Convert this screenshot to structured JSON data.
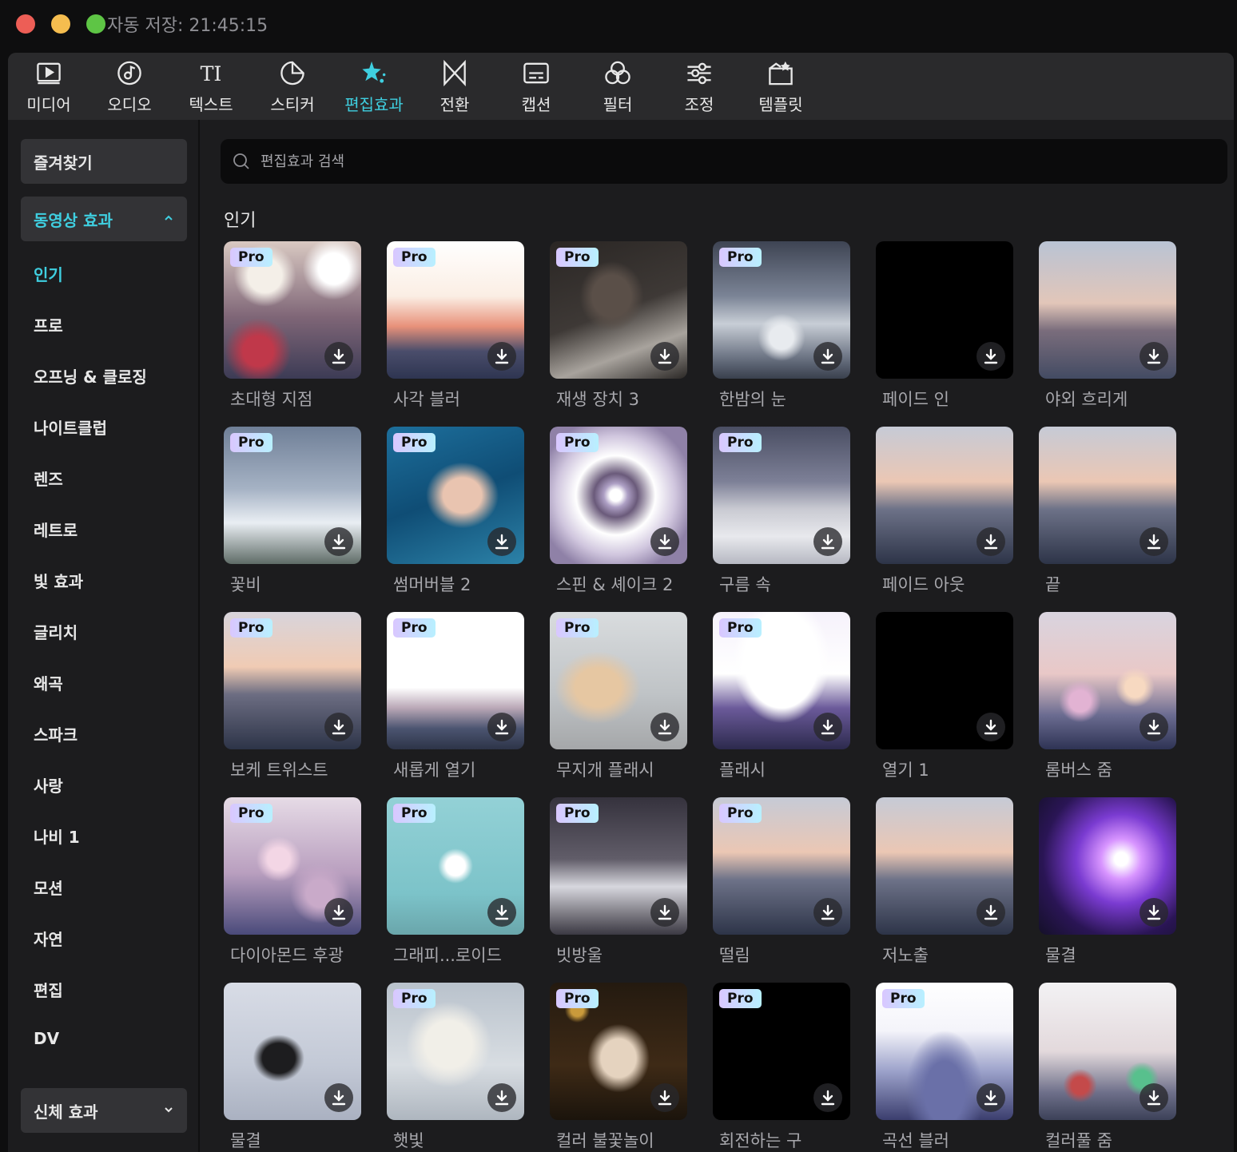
{
  "titlebar": {
    "autosave": "자동 저장: 21:45:15"
  },
  "toolbar": [
    {
      "label": "미디어",
      "icon": "media-icon",
      "active": false
    },
    {
      "label": "오디오",
      "icon": "audio-icon",
      "active": false
    },
    {
      "label": "텍스트",
      "icon": "text-icon",
      "active": false
    },
    {
      "label": "스티커",
      "icon": "sticker-icon",
      "active": false
    },
    {
      "label": "편집효과",
      "icon": "effects-icon",
      "active": true
    },
    {
      "label": "전환",
      "icon": "transition-icon",
      "active": false
    },
    {
      "label": "캡션",
      "icon": "caption-icon",
      "active": false
    },
    {
      "label": "필터",
      "icon": "filter-icon",
      "active": false
    },
    {
      "label": "조정",
      "icon": "adjust-icon",
      "active": false
    },
    {
      "label": "템플릿",
      "icon": "template-icon",
      "active": false
    }
  ],
  "sidebar": {
    "favorites": "즐겨찾기",
    "video_effects": "동영상 효과",
    "items": [
      "인기",
      "프로",
      "오프닝 & 클로징",
      "나이트클럽",
      "렌즈",
      "레트로",
      "빛 효과",
      "글리치",
      "왜곡",
      "스파크",
      "사랑",
      "나비 1",
      "모션",
      "자연",
      "편집",
      "DV"
    ],
    "active_item": "인기",
    "body_effects": "신체 효과"
  },
  "search": {
    "placeholder": "편집효과 검색"
  },
  "section_title": "인기",
  "pro_label": "Pro",
  "colors": {
    "accent": "#3fcfe0",
    "background": "#1c1c1e",
    "panel": "#2a2a2c"
  },
  "effects": [
    {
      "name": "초대형 지점",
      "pro": true
    },
    {
      "name": "사각 블러",
      "pro": true
    },
    {
      "name": "재생 장치 3",
      "pro": true
    },
    {
      "name": "한밤의 눈",
      "pro": true
    },
    {
      "name": "페이드 인",
      "pro": false
    },
    {
      "name": "야외 흐리게",
      "pro": false
    },
    {
      "name": "꽃비",
      "pro": true
    },
    {
      "name": "썸머버블 2",
      "pro": true
    },
    {
      "name": "스핀 & 셰이크 2",
      "pro": true
    },
    {
      "name": "구름 속",
      "pro": true
    },
    {
      "name": "페이드 아웃",
      "pro": false
    },
    {
      "name": "끝",
      "pro": false
    },
    {
      "name": "보케 트위스트",
      "pro": true
    },
    {
      "name": "새롭게 열기",
      "pro": true
    },
    {
      "name": "무지개 플래시",
      "pro": true
    },
    {
      "name": "플래시",
      "pro": true
    },
    {
      "name": "열기 1",
      "pro": false
    },
    {
      "name": "롬버스 줌",
      "pro": false
    },
    {
      "name": "다이아몬드 후광",
      "pro": true
    },
    {
      "name": "그래피...로이드",
      "pro": true
    },
    {
      "name": "빗방울",
      "pro": true
    },
    {
      "name": "떨림",
      "pro": true
    },
    {
      "name": "저노출",
      "pro": false
    },
    {
      "name": "물결",
      "pro": false
    },
    {
      "name": "물결",
      "pro": false
    },
    {
      "name": "햇빛",
      "pro": true
    },
    {
      "name": "컬러 불꽃놀이",
      "pro": true
    },
    {
      "name": "회전하는 구",
      "pro": true
    },
    {
      "name": "곡선 블러",
      "pro": true
    },
    {
      "name": "컬러풀 줌",
      "pro": false
    }
  ]
}
